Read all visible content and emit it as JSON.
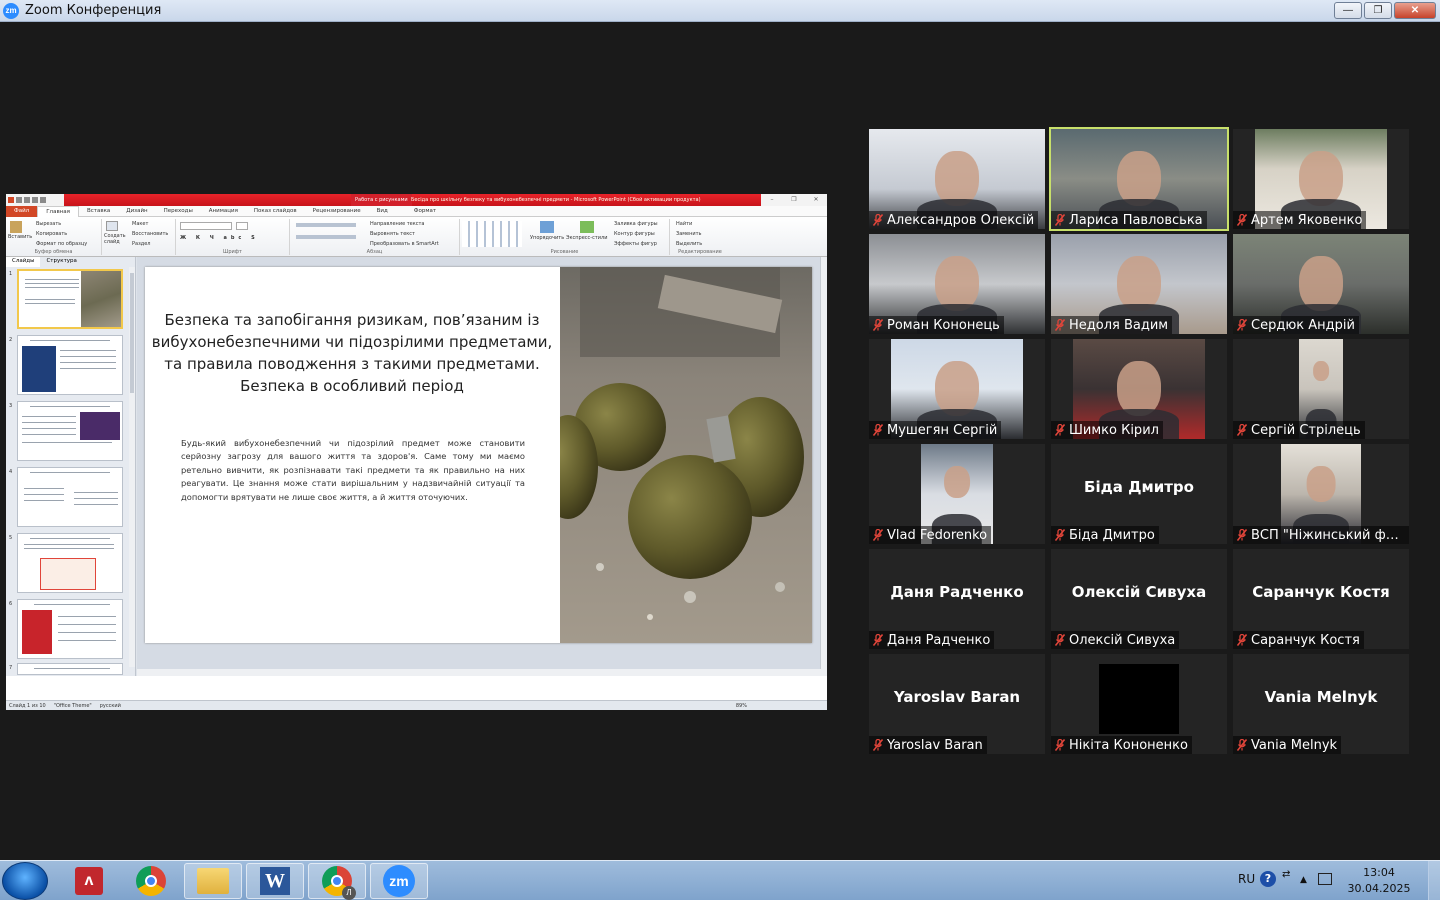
{
  "window": {
    "title": "Zoom Конференция",
    "logo": "zm"
  },
  "window_buttons": {
    "minimize": "—",
    "maximize": "❐",
    "close": "✕"
  },
  "powerpoint": {
    "contextual_tab": "Работа с рисунками",
    "doc_title": "Бесіда про шкільну безпеку та вибухонебезпечні предмети - Microsoft PowerPoint (Сбой активации продукта)",
    "tabs": [
      "Файл",
      "Главная",
      "Вставка",
      "Дизайн",
      "Переходы",
      "Анимация",
      "Показ слайдов",
      "Рецензирование",
      "Вид",
      "Формат"
    ],
    "ribbon": {
      "clipboard": {
        "paste": "Вставить",
        "cut": "Вырезать",
        "copy": "Копировать",
        "format_painter": "Формат по образцу",
        "group": "Буфер обмена"
      },
      "slides": {
        "new_slide": "Создать слайд",
        "layout": "Макет",
        "reset": "Восстановить",
        "section": "Раздел",
        "group": "Слайды"
      },
      "font_group": "Шрифт",
      "paragraph": {
        "text_direction": "Направление текста",
        "align_text": "Выровнять текст",
        "smartart": "Преобразовать в SmartArt",
        "group": "Абзац"
      },
      "drawing": {
        "arrange": "Упорядочить",
        "quick_styles": "Экспресс-стили",
        "fill": "Заливка фигуры",
        "outline": "Контур фигуры",
        "effects": "Эффекты фигур",
        "group": "Рисование"
      },
      "editing": {
        "find": "Найти",
        "replace": "Заменить",
        "select": "Выделить",
        "group": "Редактирование"
      }
    },
    "panel_tabs": [
      "Слайды",
      "Структура"
    ],
    "thumbnail_numbers": [
      "1",
      "2",
      "3",
      "4",
      "5",
      "6",
      "7"
    ],
    "slide": {
      "title": "Безпека та запобігання ризикам, пов’язаним із вибухонебезпечними чи підозрілими предметами, та правила поводження з такими предметами. Безпека в особливий період",
      "body": "Будь-який вибухонебезпечний чи підозрілий предмет може становити серйозну загрозу для вашого життя та здоров'я. Саме тому ми маємо ретельно вивчити, як розпізнавати такі предмети та як правильно на них реагувати. Це знання може стати вирішальним у надзвичайній ситуації та допомогти врятувати не лише своє життя, а й життя оточуючих."
    },
    "status": {
      "slide": "Слайд 1 из 10",
      "theme": "\"Office Theme\"",
      "lang": "русский",
      "zoom": "89%"
    }
  },
  "participants": [
    {
      "name": "Александров Олексій",
      "video": true
    },
    {
      "name": "Лариса Павловська",
      "video": true,
      "active": true
    },
    {
      "name": "Артем Яковенко",
      "video": true
    },
    {
      "name": "Роман Кононець",
      "video": true
    },
    {
      "name": "Недоля Вадим",
      "video": true
    },
    {
      "name": "Сердюк Андрій",
      "video": true
    },
    {
      "name": "Мушегян Сергій",
      "video": true
    },
    {
      "name": "Шимко Кірил",
      "video": true
    },
    {
      "name": "Сергій Стрілець",
      "video": true
    },
    {
      "name": "Vlad Fedorenko",
      "video": true
    },
    {
      "name": "Біда Дмитро",
      "display": "Біда Дмитро",
      "video": false
    },
    {
      "name": "ВСП \"Ніжинський фахов...",
      "video": true
    },
    {
      "name": "Даня Радченко",
      "display": "Даня Радченко",
      "video": false
    },
    {
      "name": "Олексій Сивуха",
      "display": "Олексій Сивуха",
      "video": false
    },
    {
      "name": "Саранчук Костя",
      "display": "Саранчук Костя",
      "video": false
    },
    {
      "name": "Yaroslav Baran",
      "display": "Yaroslav Baran",
      "video": false
    },
    {
      "name": "Нікіта Кононенко",
      "video": true
    },
    {
      "name": "Vania Melnyk",
      "display": "Vania Melnyk",
      "video": false
    }
  ],
  "taskbar": {
    "apps": [
      "acrobat-icon",
      "chrome-icon",
      "explorer-icon",
      "word-icon",
      "chrome-profile-icon",
      "zoom-icon"
    ],
    "word_label": "W",
    "zoom_label": "zm",
    "chrome_badge": "Л",
    "lang": "RU",
    "help": "?",
    "time": "13:04",
    "date": "30.04.2025"
  },
  "colors": {
    "accent": "#2d8cff",
    "active_speaker": "#c8e06b",
    "muted_mic": "#e0453a",
    "ppt_red": "#d2202a"
  }
}
